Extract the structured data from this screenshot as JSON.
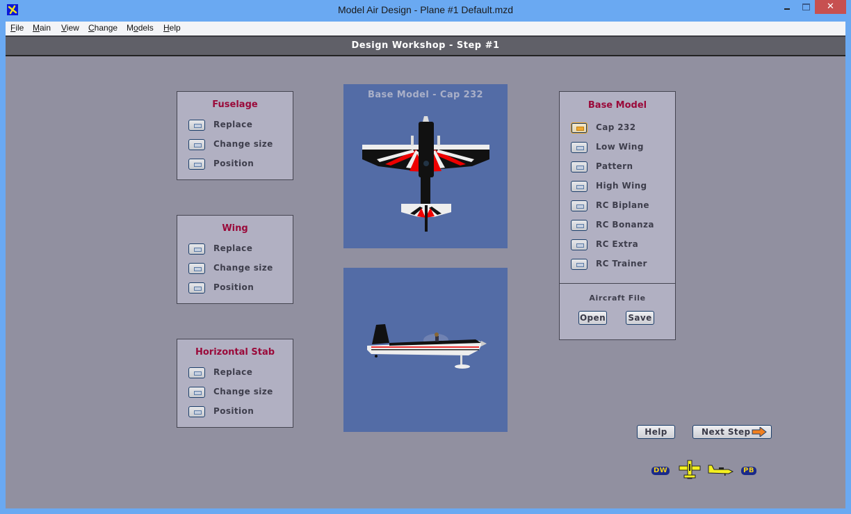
{
  "window": {
    "title": "Model Air Design - Plane #1  Default.mzd",
    "icon": "app-plane-icon",
    "controls": [
      "minimize-icon",
      "maximize-icon",
      "close-icon"
    ],
    "close_glyph": "✕"
  },
  "menu": [
    {
      "label": "File",
      "mnemonic": "F",
      "rest": "ile"
    },
    {
      "label": "Main",
      "mnemonic": "M",
      "rest": "ain"
    },
    {
      "label": "View",
      "mnemonic": "V",
      "rest": "iew"
    },
    {
      "label": "Change",
      "mnemonic": "C",
      "rest": "hange"
    },
    {
      "label": "Models",
      "pre": "M",
      "mnemonic": "o",
      "rest": "dels"
    },
    {
      "label": "Help",
      "mnemonic": "H",
      "rest": "elp"
    }
  ],
  "header": {
    "title": "Design Workshop  -  Step #1"
  },
  "panels": {
    "fuselage": {
      "title": "Fuselage",
      "options": [
        "Replace",
        "Change size",
        "Position"
      ]
    },
    "wing": {
      "title": "Wing",
      "options": [
        "Replace",
        "Change size",
        "Position"
      ]
    },
    "hstab": {
      "title": "Horizontal Stab",
      "options": [
        "Replace",
        "Change size",
        "Position"
      ]
    }
  },
  "top_view": {
    "title": "Base Model - Cap 232"
  },
  "base_model": {
    "title": "Base Model",
    "selected": "Cap 232",
    "options": [
      "Cap 232",
      "Low Wing",
      "Pattern",
      "High Wing",
      "RC Biplane",
      "RC Bonanza",
      "RC Extra",
      "RC Trainer"
    ],
    "file_section": {
      "title": "Aircraft File",
      "open_label": "Open",
      "save_label": "Save"
    }
  },
  "buttons": {
    "help_label": "Help",
    "next_label": "Next Step"
  },
  "nav_badges": {
    "left": "DW",
    "right": "PB"
  },
  "colors": {
    "accent_title": "#9a0a3a",
    "panel_bg": "#b1b0c2",
    "workspace_bg": "#9190a0",
    "view_bg": "#536ca6",
    "titlebar": "#6aa9f2",
    "close_red": "#c75050",
    "arrow_orange": "#f08020",
    "plane_yellow": "#f4f020"
  }
}
